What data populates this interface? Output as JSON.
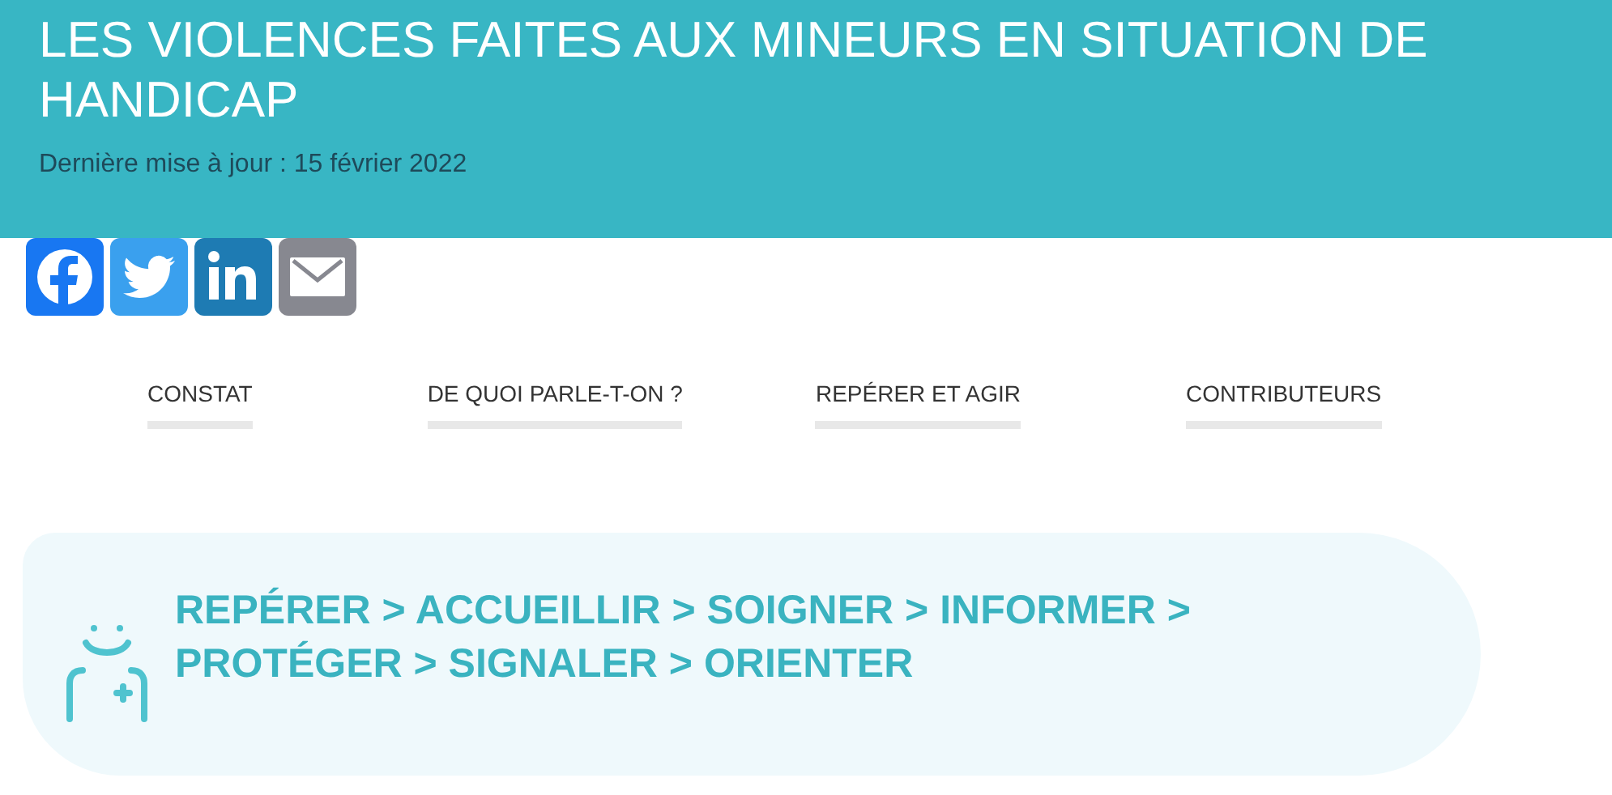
{
  "header": {
    "title": "LES VIOLENCES FAITES AUX MINEURS EN SITUATION DE HANDICAP",
    "updated": "Dernière mise à jour : 15 février 2022"
  },
  "share_buttons": [
    {
      "kind": "facebook"
    },
    {
      "kind": "twitter"
    },
    {
      "kind": "linkedin"
    },
    {
      "kind": "email"
    }
  ],
  "nav_tabs": [
    {
      "label": "CONSTAT"
    },
    {
      "label": "DE QUOI PARLE-T-ON ?"
    },
    {
      "label": "REPÉRER ET AGIR"
    },
    {
      "label": "CONTRIBUTEURS"
    }
  ],
  "callout": {
    "text": "REPÉRER > ACCUEILLIR > SOIGNER > INFORMER > PROTÉGER > SIGNALER > ORIENTER"
  }
}
